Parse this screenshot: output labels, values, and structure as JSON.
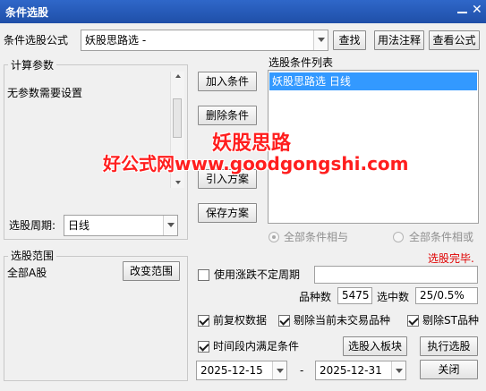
{
  "window": {
    "title": "条件选股"
  },
  "formula_row": {
    "label": "条件选股公式",
    "value": "妖股思路选  -",
    "find_button": "查找",
    "usage_button": "用法注释",
    "view_button": "查看公式"
  },
  "params": {
    "group_title": "计算参数",
    "message": "无参数需要设置",
    "period_label": "选股周期:",
    "period_value": "日线"
  },
  "actions": {
    "add": "加入条件",
    "delete": "删除条件",
    "load": "引入方案",
    "save": "保存方案"
  },
  "condition_list": {
    "title": "选股条件列表",
    "items": [
      "妖股思路选  日线"
    ]
  },
  "logic": {
    "all_and": "全部条件相与",
    "all_or": "全部条件相或"
  },
  "status": {
    "done": "选股完毕.",
    "color": "#e00000"
  },
  "range": {
    "group_title": "选股范围",
    "value": "全部A股",
    "change_button": "改变范围"
  },
  "options": {
    "irregular_period": "使用涨跌不定周期",
    "count_label": "品种数",
    "count_value": "5475",
    "selected_label": "选中数",
    "selected_value": "25/0.5%",
    "prior_adjust": "前复权数据",
    "exclude_suspended": "剔除当前未交易品种",
    "exclude_st": "剔除ST品种",
    "time_range": "时间段内满足条件"
  },
  "dates": {
    "start": "2025-12-15",
    "separator": "-",
    "end": "2025-12-31"
  },
  "bottom_buttons": {
    "to_block": "选股入板块",
    "run": "执行选股",
    "close": "关闭"
  },
  "watermark": {
    "line1": "妖股思路",
    "line2": "好公式网www.goodgongshi.com"
  }
}
